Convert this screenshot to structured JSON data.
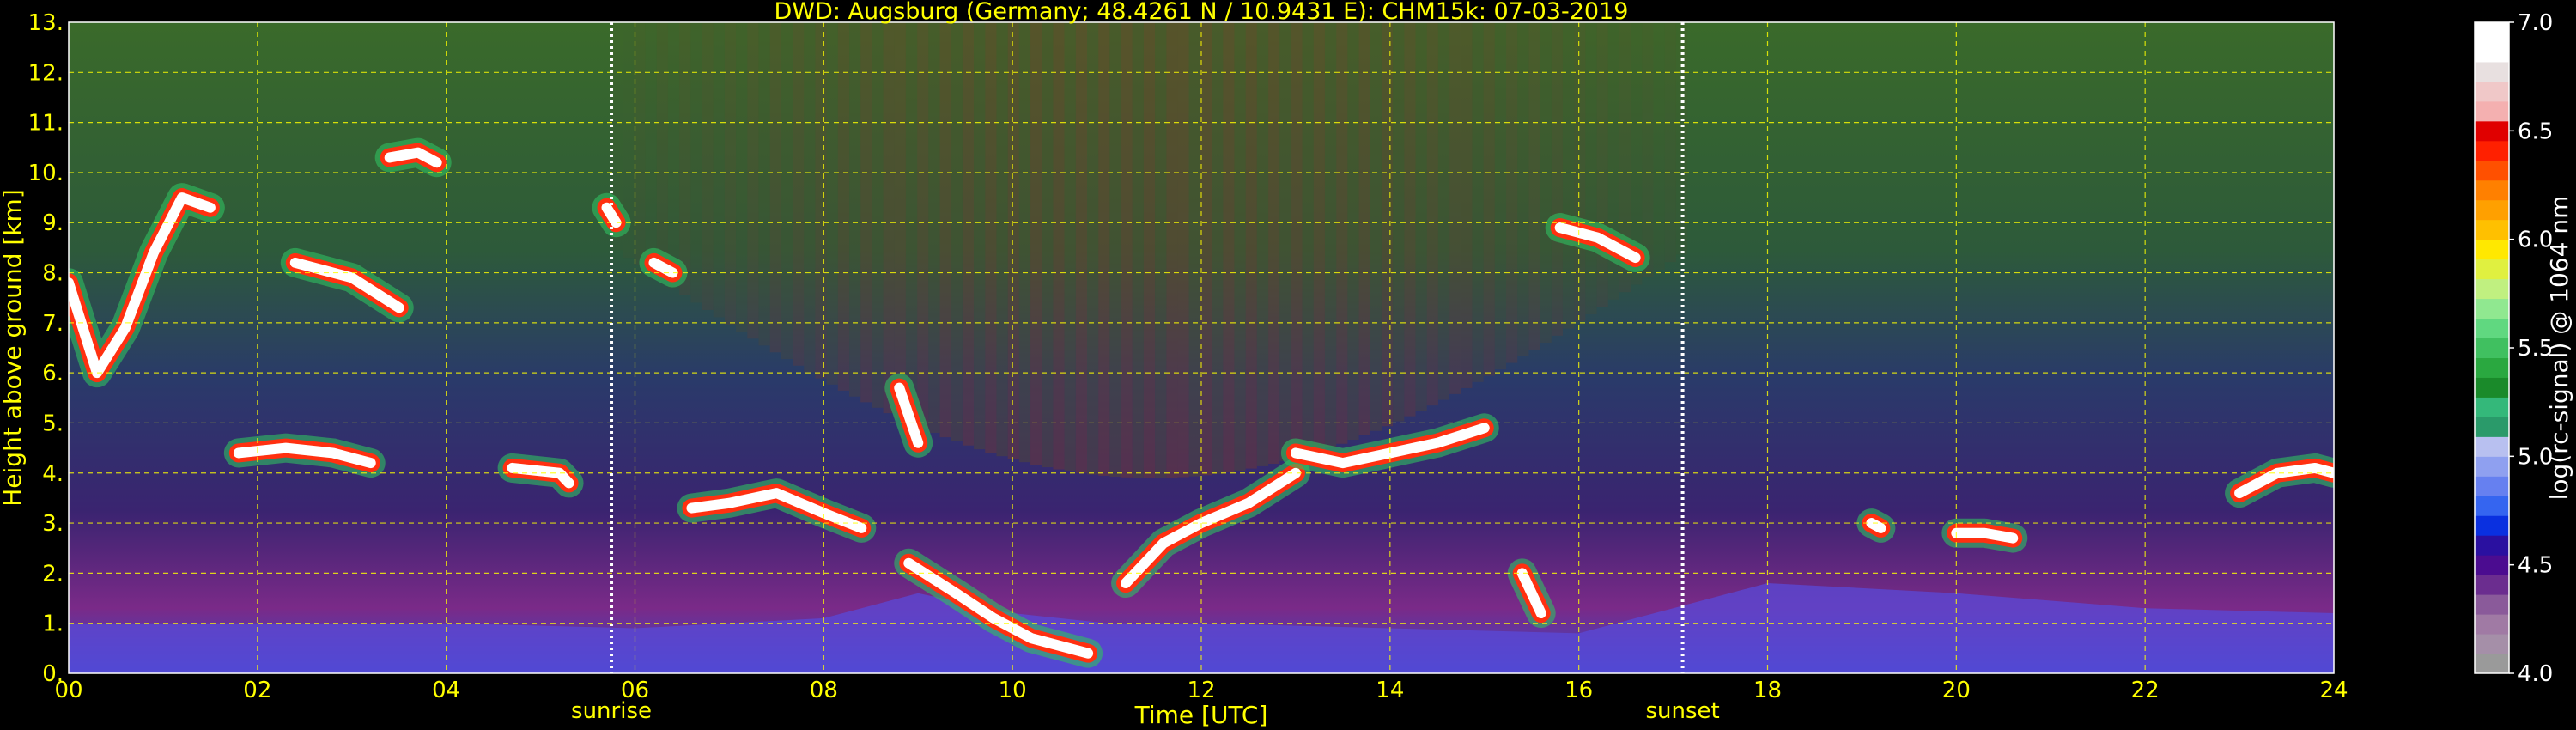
{
  "chart_data": {
    "type": "heatmap",
    "title": "DWD: Augsburg (Germany; 48.4261 N / 10.9431 E):    CHM15k: 07-03-2019",
    "xlabel": "Time [UTC]",
    "ylabel": "Height above ground [km]",
    "xlim": [
      0,
      24
    ],
    "ylim": [
      0,
      13
    ],
    "x_ticks": [
      "00",
      "02",
      "04",
      "06",
      "08",
      "10",
      "12",
      "14",
      "16",
      "18",
      "20",
      "22",
      "24"
    ],
    "y_ticks": [
      "0.",
      "1.",
      "2.",
      "3.",
      "4.",
      "5.",
      "6.",
      "7.",
      "8.",
      "9.",
      "10.",
      "11.",
      "12.",
      "13."
    ],
    "grid": true,
    "colorbar": {
      "label": "log(rc-signal) @ 1064 nm",
      "range": [
        4.0,
        7.0
      ],
      "ticks": [
        "4.0",
        "4.5",
        "5.0",
        "5.5",
        "6.0",
        "6.5",
        "7.0"
      ],
      "colors": [
        "#9a9a9a",
        "#a58fa8",
        "#a07aa4",
        "#8a5a9a",
        "#6b2d8f",
        "#4b0c90",
        "#2a10a0",
        "#0a30e0",
        "#3565f0",
        "#6680f0",
        "#8fa0f0",
        "#b8c0f0",
        "#2a9a6a",
        "#34b87a",
        "#1a8a2a",
        "#2aa840",
        "#40c060",
        "#60d880",
        "#90e890",
        "#c0f080",
        "#e0f040",
        "#ffe800",
        "#ffc000",
        "#ffa000",
        "#ff8000",
        "#ff5000",
        "#ff2000",
        "#e00000",
        "#f4b0b0",
        "#f0c8c8",
        "#e8e0e0",
        "#ffffff",
        "#ffffff"
      ]
    },
    "annotations": [
      {
        "label": "sunrise",
        "x": 5.75
      },
      {
        "label": "sunset",
        "x": 17.1
      }
    ],
    "cloud_layers": [
      {
        "x": [
          0.0,
          0.3,
          0.6,
          0.9,
          1.2,
          1.5
        ],
        "y": [
          7.8,
          6.0,
          6.9,
          8.4,
          9.5,
          9.3
        ]
      },
      {
        "x": [
          1.8,
          2.3,
          2.8,
          3.2
        ],
        "y": [
          4.4,
          4.5,
          4.4,
          4.2
        ]
      },
      {
        "x": [
          2.4,
          3.0,
          3.5
        ],
        "y": [
          8.2,
          7.9,
          7.3
        ]
      },
      {
        "x": [
          3.4,
          3.7,
          3.9
        ],
        "y": [
          10.3,
          10.4,
          10.2
        ]
      },
      {
        "x": [
          4.7,
          5.2,
          5.3
        ],
        "y": [
          4.1,
          4.0,
          3.8
        ]
      },
      {
        "x": [
          5.7,
          5.8
        ],
        "y": [
          9.3,
          9.0
        ]
      },
      {
        "x": [
          6.2,
          6.4
        ],
        "y": [
          8.2,
          8.0
        ]
      },
      {
        "x": [
          6.6,
          7.0,
          7.5,
          8.0,
          8.4
        ],
        "y": [
          3.3,
          3.4,
          3.6,
          3.2,
          2.9
        ]
      },
      {
        "x": [
          8.8,
          9.0
        ],
        "y": [
          5.7,
          4.6
        ]
      },
      {
        "x": [
          8.9,
          9.4,
          9.8,
          10.2,
          10.6,
          10.8
        ],
        "y": [
          2.2,
          1.6,
          1.1,
          0.7,
          0.5,
          0.4
        ]
      },
      {
        "x": [
          11.2,
          11.6,
          12.0,
          12.5,
          13.0
        ],
        "y": [
          1.8,
          2.6,
          3.0,
          3.4,
          4.0
        ]
      },
      {
        "x": [
          13.0,
          13.5,
          14.0,
          14.5,
          15.0
        ],
        "y": [
          4.4,
          4.2,
          4.4,
          4.6,
          4.9
        ]
      },
      {
        "x": [
          15.4,
          15.6
        ],
        "y": [
          2.0,
          1.2
        ]
      },
      {
        "x": [
          15.8,
          16.2,
          16.6
        ],
        "y": [
          8.9,
          8.7,
          8.3
        ]
      },
      {
        "x": [
          19.1,
          19.2
        ],
        "y": [
          3.0,
          2.9
        ]
      },
      {
        "x": [
          20.0,
          20.3,
          20.6
        ],
        "y": [
          2.8,
          2.8,
          2.7
        ]
      },
      {
        "x": [
          23.0,
          23.4,
          23.8,
          24.0
        ],
        "y": [
          3.6,
          4.0,
          4.1,
          4.0
        ]
      }
    ],
    "boundary_layer": {
      "x": [
        0,
        2,
        4,
        6,
        8,
        9,
        10,
        11,
        12,
        14,
        16,
        17,
        18,
        20,
        22,
        24
      ],
      "y": [
        1.0,
        1.0,
        1.0,
        0.9,
        1.1,
        1.6,
        1.2,
        1.0,
        1.0,
        0.9,
        0.8,
        1.3,
        1.8,
        1.6,
        1.3,
        1.2
      ]
    }
  }
}
